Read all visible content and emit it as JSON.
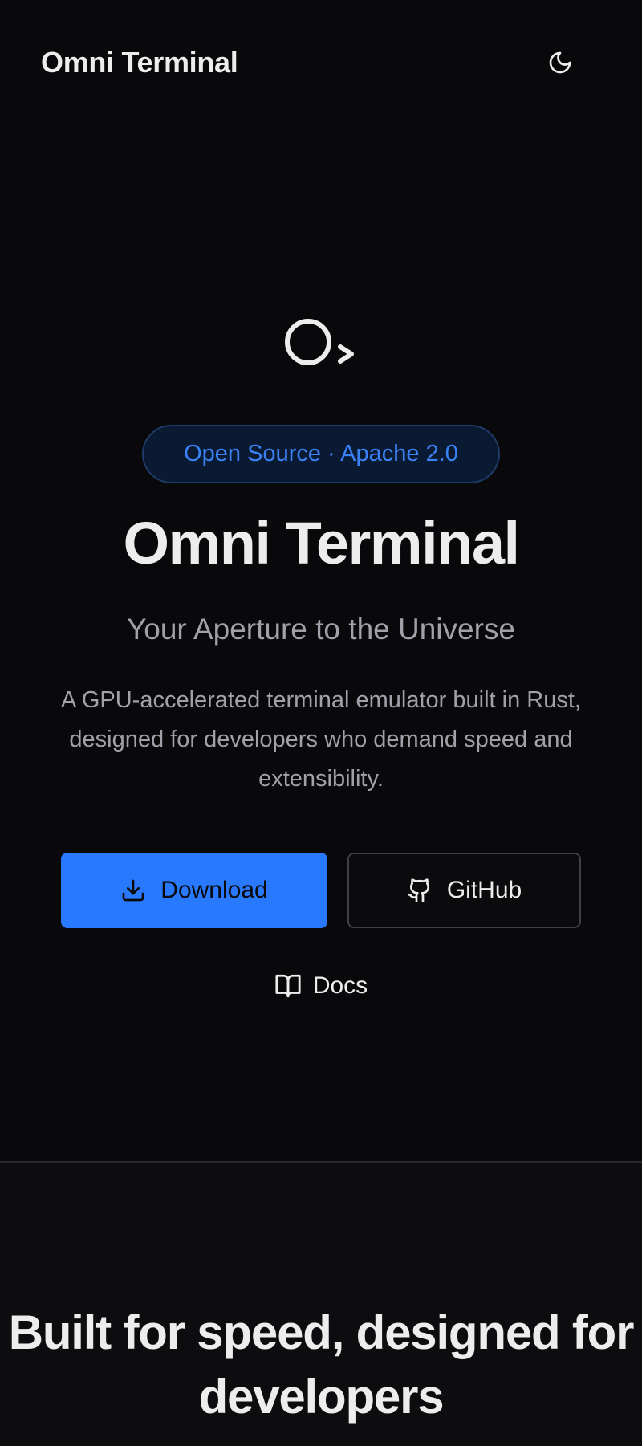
{
  "header": {
    "brand": "Omni Terminal",
    "theme_toggle_icon": "moon-icon"
  },
  "hero": {
    "logo_icon": "terminal-logo-icon",
    "badge": "Open Source · Apache 2.0",
    "title": "Omni Terminal",
    "subtitle": "Your Aperture to the Universe",
    "description": "A GPU-accelerated terminal emulator built in Rust, designed for developers who demand speed and extensibility.",
    "buttons": {
      "download": {
        "label": "Download",
        "icon": "download-icon"
      },
      "github": {
        "label": "GitHub",
        "icon": "github-icon"
      },
      "docs": {
        "label": "Docs",
        "icon": "book-icon"
      }
    }
  },
  "features": {
    "title": "Built for speed, designed for developers"
  },
  "colors": {
    "background": "#09090b",
    "accent": "#2979ff",
    "badge_text": "#3b82f6",
    "text_muted": "#a1a1aa"
  }
}
